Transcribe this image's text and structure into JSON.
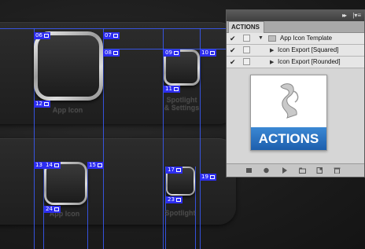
{
  "canvas": {
    "slices": {
      "s06": {
        "num": "06"
      },
      "s07": {
        "num": "07"
      },
      "s08": {
        "num": "08"
      },
      "s09": {
        "num": "09"
      },
      "s10": {
        "num": "10"
      },
      "s11": {
        "num": "11"
      },
      "s12": {
        "num": "12"
      },
      "s13": {
        "num": "13"
      },
      "s14": {
        "num": "14"
      },
      "s15": {
        "num": "15"
      },
      "s17": {
        "num": "17"
      },
      "s19": {
        "num": "19"
      },
      "s23": {
        "num": "23"
      },
      "s24": {
        "num": "24"
      }
    },
    "captions": {
      "app_icon_top": "App Icon",
      "spotlight_settings_1": "Spotlight",
      "spotlight_settings_2": "& Settings",
      "app_icon_bottom": "App Icon",
      "spotlight_bottom": "Spotlight"
    },
    "colors": {
      "guide": "#3a5cff",
      "slice_label": "#2d2df0"
    }
  },
  "actions_panel": {
    "tab": "ACTIONS",
    "rows": [
      {
        "label": "App Icon Template",
        "checked": true,
        "expanded": true
      },
      {
        "label": "Icon Export [Squared]",
        "checked": true,
        "expanded": false
      },
      {
        "label": "Icon Export [Rounded]",
        "checked": true,
        "expanded": false
      }
    ],
    "logo_text": "ACTIONS",
    "colors": {
      "logo_band": "#2a74c4"
    }
  }
}
